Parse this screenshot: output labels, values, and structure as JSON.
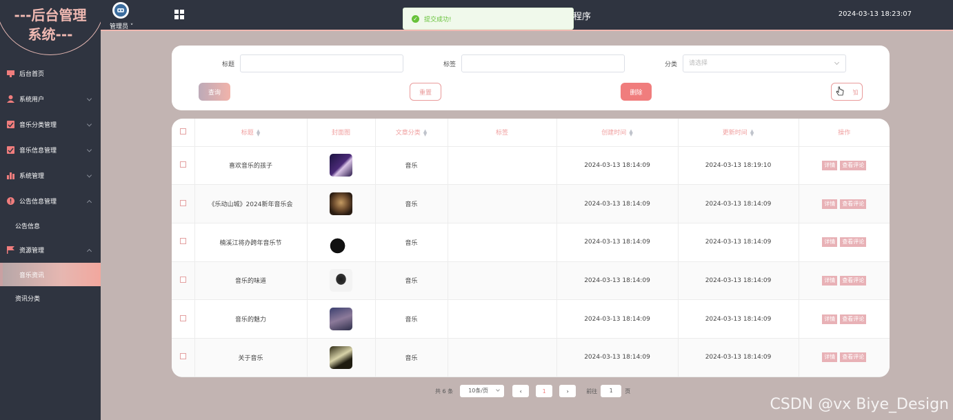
{
  "sidebar": {
    "logo": "---后台管理系统---",
    "items": [
      {
        "label": "后台首页"
      },
      {
        "label": "系统用户"
      },
      {
        "label": "音乐分类管理"
      },
      {
        "label": "音乐信息管理"
      },
      {
        "label": "系统管理"
      },
      {
        "label": "公告信息管理"
      },
      {
        "label": "公告信息"
      },
      {
        "label": "资源管理"
      },
      {
        "label": "音乐资讯"
      },
      {
        "label": "资讯分类"
      }
    ]
  },
  "header": {
    "user": "管理员",
    "title": "小程序",
    "datetime": "2024-03-13 18:23:07"
  },
  "toast": {
    "message": "提交成功!"
  },
  "search": {
    "title_label": "标题",
    "tag_label": "标签",
    "category_label": "分类",
    "category_placeholder": "请选择",
    "query_button": "查询",
    "reset_button": "重置",
    "delete_button": "删除",
    "add_button": "添加"
  },
  "table": {
    "headers": [
      "标题",
      "封面图",
      "文章分类",
      "标签",
      "创建时间",
      "更新时间",
      "操作"
    ],
    "rows": [
      {
        "title": "喜欢音乐的孩子",
        "category": "音乐",
        "tag": "",
        "created": "2024-03-13 18:14:09",
        "updated": "2024-03-13 18:19:10"
      },
      {
        "title": "《乐动山城》2024新年音乐会",
        "category": "音乐",
        "tag": "",
        "created": "2024-03-13 18:14:09",
        "updated": "2024-03-13 18:14:09"
      },
      {
        "title": "楠溪江将办跨年音乐节",
        "category": "音乐",
        "tag": "",
        "created": "2024-03-13 18:14:09",
        "updated": "2024-03-13 18:14:09"
      },
      {
        "title": "音乐的味道",
        "category": "音乐",
        "tag": "",
        "created": "2024-03-13 18:14:09",
        "updated": "2024-03-13 18:14:09"
      },
      {
        "title": "音乐的魅力",
        "category": "音乐",
        "tag": "",
        "created": "2024-03-13 18:14:09",
        "updated": "2024-03-13 18:14:09"
      },
      {
        "title": "关于音乐",
        "category": "音乐",
        "tag": "",
        "created": "2024-03-13 18:14:09",
        "updated": "2024-03-13 18:14:09"
      }
    ],
    "detail_button": "详情",
    "comment_button": "查看评论"
  },
  "pagination": {
    "total": "共 6 条",
    "page_size": "10条/页",
    "current": "1",
    "goto_prefix": "前往",
    "goto_value": "1",
    "goto_suffix": "页"
  },
  "watermark": "CSDN @vx Biye_Design",
  "colors": {
    "sidebar": "#2f3440",
    "accent": "#f07d7d",
    "page_bg": "#c2b4b2"
  }
}
